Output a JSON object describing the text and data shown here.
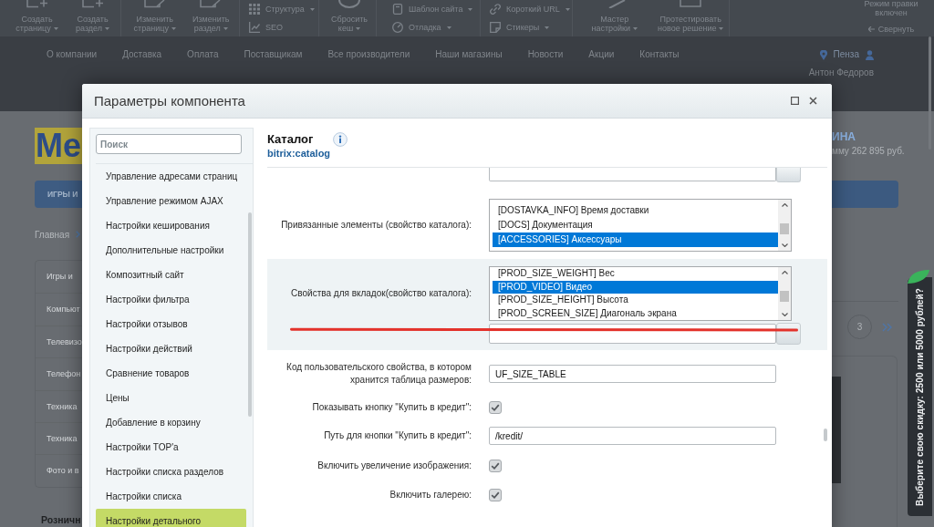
{
  "admin_toolbar": {
    "groups": [
      {
        "kind": "large",
        "items": [
          {
            "label": [
              "Создать",
              "страницу"
            ],
            "dropdown": true
          },
          {
            "label": [
              "Создать",
              "раздел"
            ],
            "dropdown": true
          }
        ]
      },
      {
        "kind": "large",
        "items": [
          {
            "label": [
              "Изменить",
              "страницу"
            ],
            "dropdown": true
          },
          {
            "label": [
              "Изменить",
              "раздел"
            ],
            "dropdown": true
          }
        ]
      },
      {
        "kind": "small",
        "items": [
          {
            "label": [
              "Структура"
            ],
            "dropdown": true
          },
          {
            "label": [
              "SEO"
            ],
            "dropdown": false
          }
        ]
      },
      {
        "kind": "large",
        "items": [
          {
            "label": [
              "Сбросить",
              "кеш"
            ],
            "dropdown": true
          }
        ]
      },
      {
        "kind": "small",
        "items": [
          {
            "label": [
              "Шаблон сайта"
            ],
            "dropdown": true
          },
          {
            "label": [
              "Отладка"
            ],
            "dropdown": true
          }
        ]
      },
      {
        "kind": "small",
        "items": [
          {
            "label": [
              "Короткий URL"
            ],
            "dropdown": true
          },
          {
            "label": [
              "Стикеры"
            ],
            "dropdown": true
          }
        ]
      },
      {
        "kind": "large",
        "items": [
          {
            "label": [
              "Мастер",
              "настройки"
            ],
            "dropdown": true
          },
          {
            "label": [
              "Протестировать",
              "новое решение"
            ],
            "dropdown": true
          }
        ]
      }
    ],
    "edit_mode": {
      "label": [
        "Режим правки",
        "включен"
      ]
    },
    "collapse": {
      "label": "Свернуть"
    }
  },
  "site_nav": {
    "items": [
      "О компании",
      "Доставка",
      "Оплата",
      "Поставщикам",
      "Все производители",
      "Наши магазины",
      "Новости",
      "Акции",
      "Контакты"
    ],
    "city": "Пенза",
    "user": "Антон Федоров"
  },
  "page": {
    "logo": "Me",
    "catalog_button": "ИГРЫ И",
    "breadcrumb": "Главная",
    "menu_items": [
      "Игры и",
      "Компьют",
      "Телевизо",
      "Телефон",
      "Техника",
      "Техника",
      "Фото и в"
    ],
    "section_heading": "Розничн",
    "cart_title": "ИНА",
    "cart_total": "мму 262 895 руб.",
    "pagination": [
      "3"
    ]
  },
  "promo_tab": {
    "label": "Выберите свою скидку: 2500 или 5000 рублей?"
  },
  "dialog": {
    "title": "Параметры компонента",
    "sidebar": {
      "search": {
        "placeholder": "Поиск"
      },
      "items": [
        {
          "label": "Управление адресами страниц",
          "selected": false
        },
        {
          "label": "Управление режимом AJAX",
          "selected": false
        },
        {
          "label": "Настройки кеширования",
          "selected": false
        },
        {
          "label": "Дополнительные настройки",
          "selected": false
        },
        {
          "label": "Композитный сайт",
          "selected": false
        },
        {
          "label": "Настройки фильтра",
          "selected": false
        },
        {
          "label": "Настройки отзывов",
          "selected": false
        },
        {
          "label": "Настройки действий",
          "selected": false
        },
        {
          "label": "Сравнение товаров",
          "selected": false
        },
        {
          "label": "Цены",
          "selected": false
        },
        {
          "label": "Добавление в корзину",
          "selected": false
        },
        {
          "label": "Настройки TOP'а",
          "selected": false
        },
        {
          "label": "Настройки списка разделов",
          "selected": false
        },
        {
          "label": "Настройки списка",
          "selected": false
        },
        {
          "label": "Настройки детального",
          "selected": true
        }
      ]
    },
    "component": {
      "name": "Каталог",
      "code": "bitrix:catalog"
    },
    "fields": [
      {
        "kind": "input_button"
      },
      {
        "kind": "multiselect",
        "label": "Привязанные элементы (свойство каталога):",
        "options": [
          {
            "label": "[DOSTAVKA_INFO] Время доставки",
            "selected": false
          },
          {
            "label": "[DOCS] Документация",
            "selected": false
          },
          {
            "label": "[ACCESSORIES] Аксессуары",
            "selected": true
          }
        ]
      },
      {
        "kind": "multiselect",
        "label": "Свойства для вкладок(свойство каталога):",
        "highlighted": true,
        "with_input": true,
        "annotated": true,
        "options": [
          {
            "label": "[PROD_SIZE_WEIGHT] Вес",
            "selected": false
          },
          {
            "label": "[PROD_VIDEO] Видео",
            "selected": true
          },
          {
            "label": "[PROD_SIZE_HEIGHT] Высота",
            "selected": false
          },
          {
            "label": "[PROD_SCREEN_SIZE] Диагональ экрана",
            "selected": false
          }
        ]
      },
      {
        "kind": "text",
        "label": "Код пользовательского свойства, в котором хранится таблица размеров:",
        "value": "UF_SIZE_TABLE"
      },
      {
        "kind": "checkbox",
        "label": "Показывать кнопку \"Купить в кредит\":",
        "checked": true
      },
      {
        "kind": "text",
        "label": "Путь для кнопки \"Купить в кредит\":",
        "value": "/kredit/"
      },
      {
        "kind": "checkbox",
        "label": "Включить увеличение изображения:",
        "checked": true
      },
      {
        "kind": "checkbox",
        "label": "Включить галерею:",
        "checked": true
      }
    ]
  }
}
